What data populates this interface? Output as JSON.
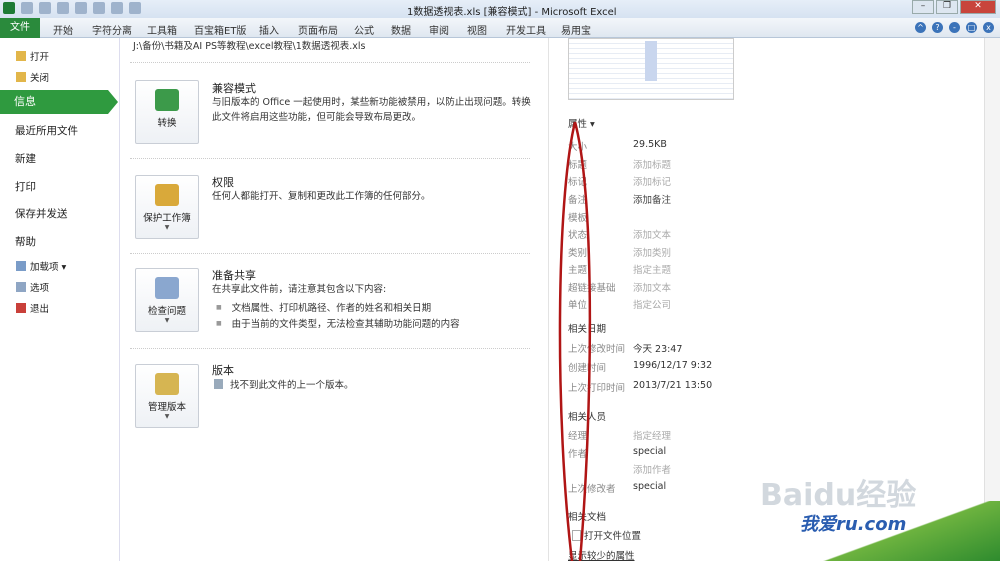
{
  "window": {
    "title": "1数据透视表.xls  [兼容模式] - Microsoft Excel"
  },
  "ribbon": {
    "file": "文件",
    "tabs": [
      "开始",
      "字符分离",
      "工具箱",
      "百宝箱ET版",
      "插入",
      "页面布局",
      "公式",
      "数据",
      "审阅",
      "视图",
      "开发工具",
      "易用宝"
    ]
  },
  "left": {
    "open": "打开",
    "close": "关闭",
    "info": "信息",
    "recent": "最近所用文件",
    "new": "新建",
    "print": "打印",
    "save_send": "保存并发送",
    "help": "帮助",
    "addins": "加载项 ▾",
    "options": "选项",
    "exit": "退出"
  },
  "main": {
    "path": "J:\\备份\\书籍及AI PS等教程\\excel教程\\1数据透视表.xls",
    "compat": {
      "button": "转换",
      "title": "兼容模式",
      "desc": "与旧版本的 Office 一起使用时，某些新功能被禁用，以防止出现问题。转换此文件将启用这些功能，但可能会导致布局更改。"
    },
    "perm": {
      "button": "保护工作簿",
      "title": "权限",
      "desc": "任何人都能打开、复制和更改此工作簿的任何部分。"
    },
    "share": {
      "button": "检查问题",
      "title": "准备共享",
      "desc": "在共享此文件前，请注意其包含以下内容:",
      "bullets": [
        "文档属性、打印机路径、作者的姓名和相关日期",
        "由于当前的文件类型，无法检查其辅助功能问题的内容"
      ]
    },
    "version": {
      "button": "管理版本",
      "title": "版本",
      "desc": "找不到此文件的上一个版本。"
    }
  },
  "props": {
    "header": "属性 ▾",
    "items": [
      [
        "大小",
        "29.5KB"
      ],
      [
        "标题",
        "添加标题"
      ],
      [
        "标记",
        "添加标记"
      ],
      [
        "备注",
        "添加备注"
      ],
      [
        "模板",
        ""
      ],
      [
        "状态",
        "添加文本"
      ],
      [
        "类别",
        "添加类别"
      ],
      [
        "主题",
        "指定主题"
      ],
      [
        "超链接基础",
        "添加文本"
      ],
      [
        "单位",
        "指定公司"
      ]
    ],
    "dates_header": "相关日期",
    "dates": [
      [
        "上次修改时间",
        "今天 23:47"
      ],
      [
        "创建时间",
        "1996/12/17 9:32"
      ],
      [
        "上次打印时间",
        "2013/7/21 13:50"
      ]
    ],
    "people_header": "相关人员",
    "manager": [
      "经理",
      "指定经理"
    ],
    "author": [
      "作者",
      "special"
    ],
    "add_author": "添加作者",
    "last_mod": [
      "上次修改者",
      "special"
    ],
    "docs_header": "相关文档",
    "open_loc": "打开文件位置",
    "show_fewer": "显示较少的属性"
  },
  "watermark": {
    "baidu": "Baidu经验",
    "site": "我爱ru.com"
  },
  "colors": {
    "accent": "#2f9a3f",
    "annotation": "#b01515"
  }
}
